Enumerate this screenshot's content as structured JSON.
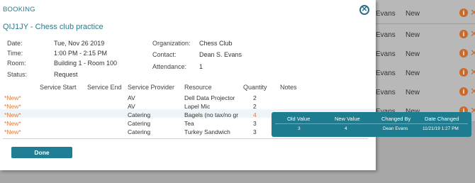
{
  "background_list": {
    "rows": [
      {
        "who": "",
        "status": ""
      },
      {
        "who": "Evans",
        "status": "New"
      },
      {
        "who": "Evans",
        "status": "New"
      },
      {
        "who": "Evans",
        "status": "New"
      },
      {
        "who": "Evans",
        "status": "New"
      },
      {
        "who": "Evans",
        "status": "New"
      }
    ],
    "info_glyph": "i",
    "remove_glyph": "✕"
  },
  "modal": {
    "title": "BOOKING",
    "close_glyph": "✕",
    "booking_title": "QIJ1JY - Chess club practice",
    "fields": {
      "date_label": "Date:",
      "date_value": "Tue, Nov 26 2019",
      "time_label": "Time:",
      "time_value": "1:00 PM - 2:15 PM",
      "room_label": "Room:",
      "room_value": "Building 1 - Room 100",
      "status_label": "Status:",
      "status_value": "Request",
      "org_label": "Organization:",
      "org_value": "Chess Club",
      "contact_label": "Contact:",
      "contact_value": "Dean S. Evans",
      "attendance_label": "Attendance:",
      "attendance_value": "1"
    },
    "table": {
      "headers": [
        "Service Start",
        "Service End",
        "Service Provider",
        "Resource",
        "Quantity",
        "Notes"
      ],
      "rows": [
        {
          "flag": "*New*",
          "provider": "AV",
          "resource": "Dell Data Projector",
          "quantity": "2"
        },
        {
          "flag": "*New*",
          "provider": "AV",
          "resource": "Lapel Mic",
          "quantity": "2"
        },
        {
          "flag": "*New*",
          "provider": "Catering",
          "resource": "Bagels (no tax/no gr",
          "quantity": "4"
        },
        {
          "flag": "*New*",
          "provider": "Catering",
          "resource": "Tea",
          "quantity": "3"
        },
        {
          "flag": "*New*",
          "provider": "Catering",
          "resource": "Turkey Sandwich",
          "quantity": "3"
        }
      ]
    },
    "done_label": "Done"
  },
  "tooltip": {
    "headers": [
      "Old Value",
      "New Value",
      "Changed By",
      "Date Changed"
    ],
    "values": [
      "3",
      "4",
      "Dean Evans",
      "11/21/19 1:27 PM"
    ]
  },
  "colors": {
    "accent": "#1f7d94",
    "new_flag": "#e07b3a",
    "title": "#2a7a8c"
  }
}
